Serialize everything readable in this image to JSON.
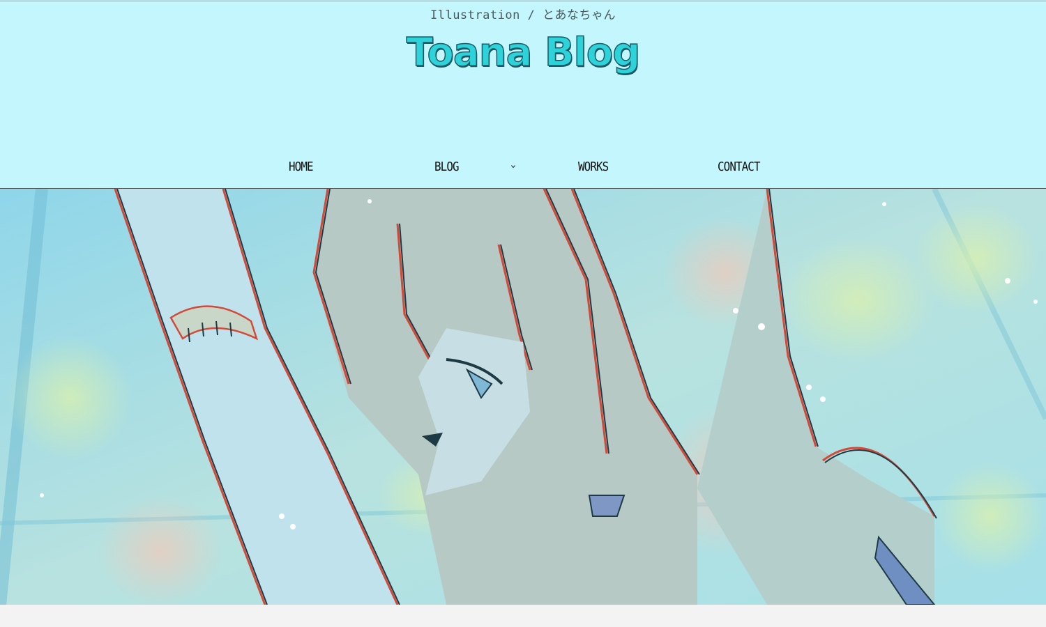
{
  "header": {
    "tagline": "Illustration / とあなちゃん",
    "title": "Toana Blog",
    "background": "#c3f6fd",
    "title_color": "#2ed3d9"
  },
  "nav": {
    "items": [
      {
        "label": "HOME"
      },
      {
        "label": "BLOG",
        "has_submenu": true
      },
      {
        "label": "WORKS"
      },
      {
        "label": "CONTACT"
      }
    ],
    "submenu_icon": "chevron-down-icon"
  },
  "hero": {
    "image": "anime-girl-illustration",
    "tint": "#9fd9e6"
  }
}
